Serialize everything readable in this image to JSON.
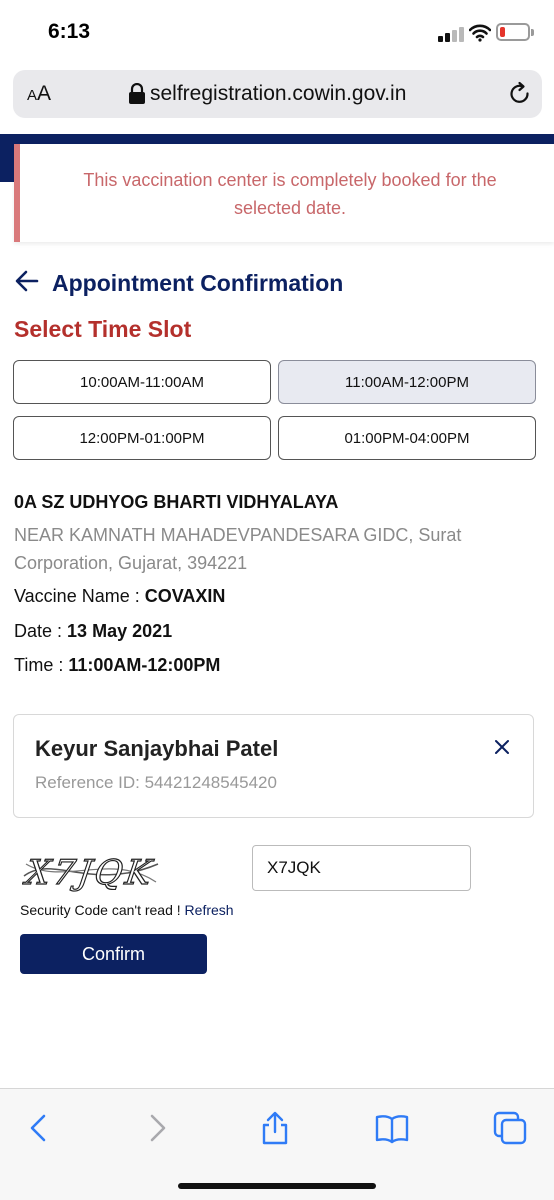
{
  "status_bar": {
    "time": "6:13"
  },
  "browser": {
    "text_size_label": "AA",
    "url": "selfregistration.cowin.gov.in"
  },
  "alert": {
    "message": "This vaccination center is completely booked for the selected date."
  },
  "page": {
    "title": "Appointment Confirmation",
    "slot_heading": "Select Time Slot"
  },
  "slots": [
    {
      "label": "10:00AM-11:00AM",
      "selected": false
    },
    {
      "label": "11:00AM-12:00PM",
      "selected": true
    },
    {
      "label": "12:00PM-01:00PM",
      "selected": false
    },
    {
      "label": "01:00PM-04:00PM",
      "selected": false
    }
  ],
  "center": {
    "name": "0A SZ UDHYOG BHARTI VIDHYALAYA",
    "address": "NEAR KAMNATH MAHADEVPANDESARA GIDC, Surat Corporation, Gujarat, 394221",
    "vaccine_label": "Vaccine Name :",
    "vaccine_value": "COVAXIN",
    "date_label": "Date :",
    "date_value": "13 May 2021",
    "time_label": "Time :",
    "time_value": "11:00AM-12:00PM"
  },
  "beneficiary": {
    "name": "Keyur Sanjaybhai Patel",
    "reference": "Reference ID: 54421248545420"
  },
  "captcha": {
    "image_text": "X7JQK",
    "input_value": "X7JQK",
    "help_text": "Security Code can't read ! ",
    "refresh_label": "Refresh"
  },
  "actions": {
    "confirm_label": "Confirm"
  },
  "colors": {
    "brand_navy": "#0c2161",
    "alert_red": "#c8676a",
    "heading_red": "#b4302c",
    "toolbar_blue": "#2f7bf6"
  },
  "toolbar_icons": [
    "back-icon",
    "forward-icon",
    "share-icon",
    "bookmarks-icon",
    "tabs-icon"
  ]
}
